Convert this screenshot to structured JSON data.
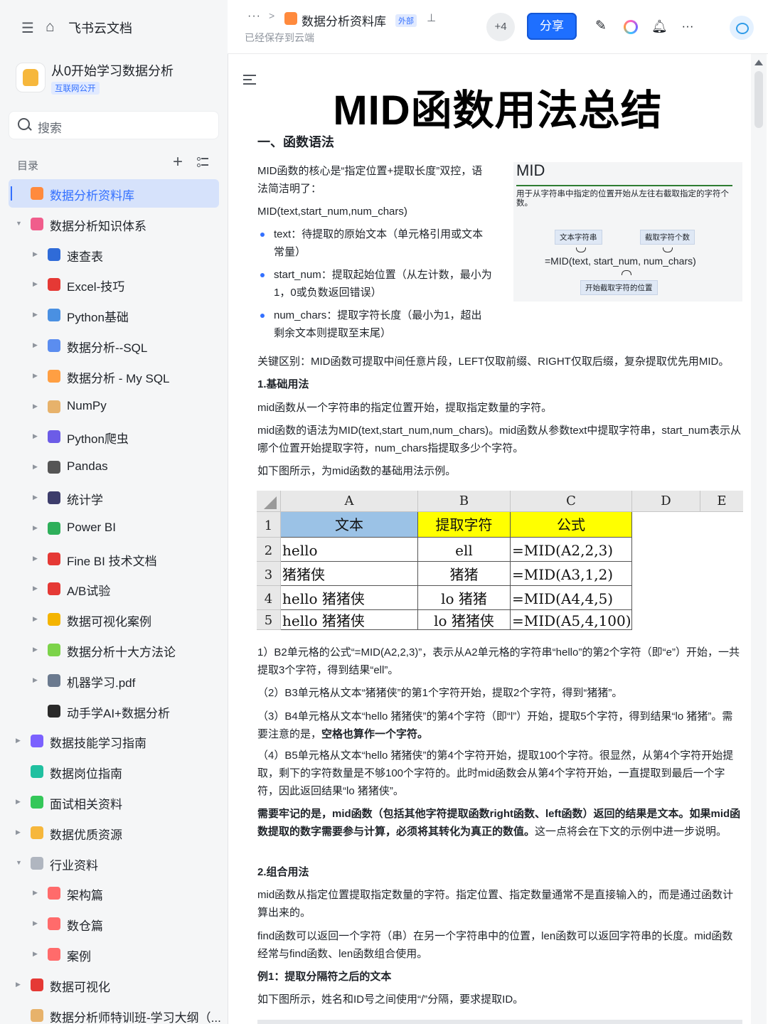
{
  "app": {
    "name": "飞书云文档"
  },
  "workspace": {
    "title": "从0开始学习数据分析",
    "badge": "互联网公开",
    "search_placeholder": "搜索",
    "toc_label": "目录"
  },
  "sidebar": {
    "items": [
      {
        "label": "数据分析资料库",
        "level": 0,
        "arrow": "",
        "icon_color": "#ff8a3d",
        "icon": "folder-icon",
        "active": true
      },
      {
        "label": "数据分析知识体系",
        "level": 0,
        "arrow": "▼",
        "icon_color": "#f05d8c",
        "icon": "doc-icon"
      },
      {
        "label": "速查表",
        "level": 1,
        "arrow": "▶",
        "icon_color": "#2f6bd8",
        "icon": "magnifier-emoji-icon"
      },
      {
        "label": "Excel-技巧",
        "level": 1,
        "arrow": "▶",
        "icon_color": "#e53935",
        "icon": "hundred-emoji-icon"
      },
      {
        "label": "Python基础",
        "level": 1,
        "arrow": "▶",
        "icon_color": "#4a90e2",
        "icon": "computer-emoji-icon"
      },
      {
        "label": "数据分析--SQL",
        "level": 1,
        "arrow": "▶",
        "icon_color": "#5b8def",
        "icon": "bar-chart-emoji-icon"
      },
      {
        "label": "数据分析 - My SQL",
        "level": 1,
        "arrow": "▶",
        "icon_color": "#ff9f43",
        "icon": "rainbow-emoji-icon"
      },
      {
        "label": "NumPy",
        "level": 1,
        "arrow": "▶",
        "icon_color": "#e7b26b",
        "icon": "memo-emoji-icon"
      },
      {
        "label": "Python爬虫",
        "level": 1,
        "arrow": "▶",
        "icon_color": "#6c5ce7",
        "icon": "spider-emoji-icon"
      },
      {
        "label": "Pandas",
        "level": 1,
        "arrow": "▶",
        "icon_color": "#555555",
        "icon": "panda-emoji-icon"
      },
      {
        "label": "统计学",
        "level": 1,
        "arrow": "▶",
        "icon_color": "#3d3d6b",
        "icon": "floppy-emoji-icon"
      },
      {
        "label": "Power BI",
        "level": 1,
        "arrow": "▶",
        "icon_color": "#2eaf5a",
        "icon": "recycle-emoji-icon"
      },
      {
        "label": "Fine BI 技术文档",
        "level": 1,
        "arrow": "▶",
        "icon_color": "#e53935",
        "icon": "pushpin-emoji-icon"
      },
      {
        "label": "A/B试验",
        "level": 1,
        "arrow": "▶",
        "icon_color": "#e53935",
        "icon": "ab-emoji-icon"
      },
      {
        "label": "数据可视化案例",
        "level": 1,
        "arrow": "▶",
        "icon_color": "#f4b400",
        "icon": "medal-emoji-icon"
      },
      {
        "label": "数据分析十大方法论",
        "level": 1,
        "arrow": "▶",
        "icon_color": "#7cd34a",
        "icon": "sparkle-emoji-icon"
      },
      {
        "label": "机器学习.pdf",
        "level": 1,
        "arrow": "▶",
        "icon_color": "#6b7a8f",
        "icon": "robot-emoji-icon"
      },
      {
        "label": "动手学AI+数据分析",
        "level": 1,
        "arrow": "",
        "icon_color": "#2a2a2a",
        "icon": "traffic-light-emoji-icon"
      },
      {
        "label": "数据技能学习指南",
        "level": 0,
        "arrow": "▶",
        "icon_color": "#7b61ff",
        "icon": "doc-icon"
      },
      {
        "label": "数据岗位指南",
        "level": 0,
        "arrow": "",
        "icon_color": "#20c0a0",
        "icon": "bolt-icon"
      },
      {
        "label": "面试相关资料",
        "level": 0,
        "arrow": "▶",
        "icon_color": "#34c759",
        "icon": "doc-icon"
      },
      {
        "label": "数据优质资源",
        "level": 0,
        "arrow": "▶",
        "icon_color": "#f6b73c",
        "icon": "thumbs-up-emoji-icon"
      },
      {
        "label": "行业资料",
        "level": 0,
        "arrow": "▼",
        "icon_color": "#b0b6c0",
        "icon": "ghost-emoji-icon"
      },
      {
        "label": "架构篇",
        "level": 1,
        "arrow": "▶",
        "icon_color": "#ff6b6b",
        "icon": "doc-icon"
      },
      {
        "label": "数仓篇",
        "level": 1,
        "arrow": "▶",
        "icon_color": "#ff6b6b",
        "icon": "doc-icon"
      },
      {
        "label": "案例",
        "level": 1,
        "arrow": "▶",
        "icon_color": "#ff6b6b",
        "icon": "doc-icon"
      },
      {
        "label": "数据可视化",
        "level": 0,
        "arrow": "▶",
        "icon_color": "#e53935",
        "icon": "rocket-emoji-icon"
      },
      {
        "label": "数据分析师特训班-学习大纲（...",
        "level": 0,
        "arrow": "",
        "icon_color": "#e7b26b",
        "icon": "memo-emoji-icon"
      }
    ]
  },
  "topbar": {
    "crumb_dots": "···",
    "crumb_sep": ">",
    "doc_title": "数据分析资料库",
    "tag": "外部",
    "saved": "已经保存到云端",
    "collaborators": "+4",
    "share": "分享",
    "more": "···"
  },
  "doc": {
    "title": "MID函数用法总结",
    "section1": "一、函数语法",
    "intro": "MID函数的核心是“指定位置+提取长度”双控，语法简洁明了：",
    "syntax": "MID(text,start_num,num_chars)",
    "bullets": [
      "text：待提取的原始文本（单元格引用或文本常量）",
      "start_num：提取起始位置（从左计数，最小为1，0或负数返回错误）",
      "num_chars：提取字符长度（最小为1，超出剩余文本则提取至末尾）"
    ],
    "figure": {
      "title": "MID",
      "desc": "用于从字符串中指定的位置开始从左往右截取指定的字符个数。",
      "box1": "文本字符串",
      "box2": "截取字符个数",
      "formula": "=MID(text, start_num, num_chars)",
      "box3": "开始截取字符的位置"
    },
    "key_diff": "关键区别：MID函数可提取中间任意片段，LEFT仅取前缀、RIGHT仅取后缀，复杂提取优先用MID。",
    "h_basic": "1.基础用法",
    "basic_p1": "mid函数从一个字符串的指定位置开始，提取指定数量的字符。",
    "basic_p2": "mid函数的语法为MID(text,start_num,num_chars)。mid函数从参数text中提取字符串，start_num表示从哪个位置开始提取字符，num_chars指提取多少个字符。",
    "basic_p3": "如下图所示，为mid函数的基础用法示例。",
    "sheet": {
      "cols": [
        "A",
        "B",
        "C",
        "D",
        "E"
      ],
      "rows": [
        "1",
        "2",
        "3",
        "4",
        "5"
      ],
      "header": [
        "文本",
        "提取字符",
        "公式"
      ],
      "data": [
        [
          "hello",
          "ell",
          "=MID(A2,2,3)"
        ],
        [
          "猪猪侠",
          "猪猪",
          "=MID(A3,1,2)"
        ],
        [
          "hello 猪猪侠",
          "lo 猪猪",
          "=MID(A4,4,5)"
        ],
        [
          "hello 猪猪侠",
          "lo 猪猪侠",
          "=MID(A5,4,100)"
        ]
      ],
      "colors": {
        "header_a": "#9bc2e6",
        "header_b": "#ffff00",
        "header_c": "#ffff00"
      }
    },
    "ex1": "1）B2单元格的公式“=MID(A2,2,3)”，表示从A2单元格的字符串“hello”的第2个字符（即“e”）开始，一共提取3个字符，得到结果“ell”。",
    "ex2": "（2）B3单元格从文本“猪猪侠”的第1个字符开始，提取2个字符，得到“猪猪”。",
    "ex3_a": "（3）B4单元格从文本“hello 猪猪侠”的第4个字符（即“l”）开始，提取5个字符，得到结果“lo 猪猪”。需要注意的是，",
    "ex3_b": "空格也算作一个字符。",
    "ex4": "（4）B5单元格从文本“hello 猪猪侠”的第4个字符开始，提取100个字符。很显然，从第4个字符开始提取，剩下的字符数量是不够100个字符的。此时mid函数会从第4个字符开始，一直提取到最后一个字符，因此返回结果“lo 猪猪侠”。",
    "note_bold": "需要牢记的是，mid函数（包括其他字符提取函数right函数、left函数）返回的结果是文本。如果mid函数提取的数字需要参与计算，必须将其转化为真正的数值。",
    "note_rest": "这一点将会在下文的示例中进一步说明。",
    "h_combo": "2.组合用法",
    "combo_p1": "mid函数从指定位置提取指定数量的字符。指定位置、指定数量通常不是直接输入的，而是通过函数计算出来的。",
    "combo_p2": "find函数可以返回一个字符（串）在另一个字符串中的位置，len函数可以返回字符串的长度。mid函数经常与find函数、len函数组合使用。",
    "h_ex1": "例1：提取分隔符之后的文本",
    "ex1_p": "如下图所示，姓名和ID号之间使用“/”分隔，要求提取ID。"
  }
}
